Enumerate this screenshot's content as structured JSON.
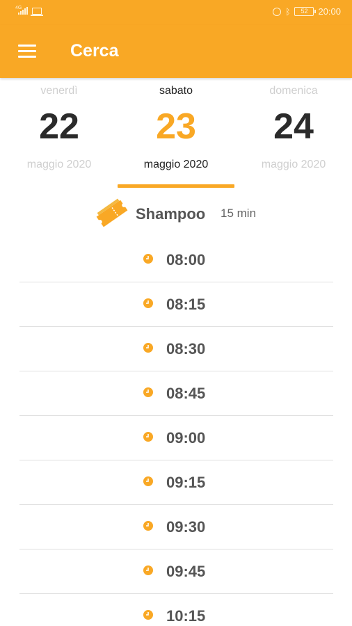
{
  "status_bar": {
    "network": "4G",
    "battery": "52",
    "time": "20:00"
  },
  "app_bar": {
    "title": "Cerca"
  },
  "days": [
    {
      "weekday": "venerdì",
      "day": "22",
      "month": "maggio 2020",
      "selected": false
    },
    {
      "weekday": "sabato",
      "day": "23",
      "month": "maggio 2020",
      "selected": true
    },
    {
      "weekday": "domenica",
      "day": "24",
      "month": "maggio 2020",
      "selected": false
    }
  ],
  "service": {
    "name": "Shampoo",
    "duration": "15 min",
    "icon": "ticket-icon"
  },
  "slots": [
    {
      "time": "08:00"
    },
    {
      "time": "08:15"
    },
    {
      "time": "08:30"
    },
    {
      "time": "08:45"
    },
    {
      "time": "09:00"
    },
    {
      "time": "09:15"
    },
    {
      "time": "09:30"
    },
    {
      "time": "09:45"
    },
    {
      "time": "10:15"
    }
  ],
  "colors": {
    "accent": "#f9a825",
    "text_dark": "#2b2b2b",
    "text_muted": "#cfcfcf",
    "divider": "#e0e0e0"
  }
}
